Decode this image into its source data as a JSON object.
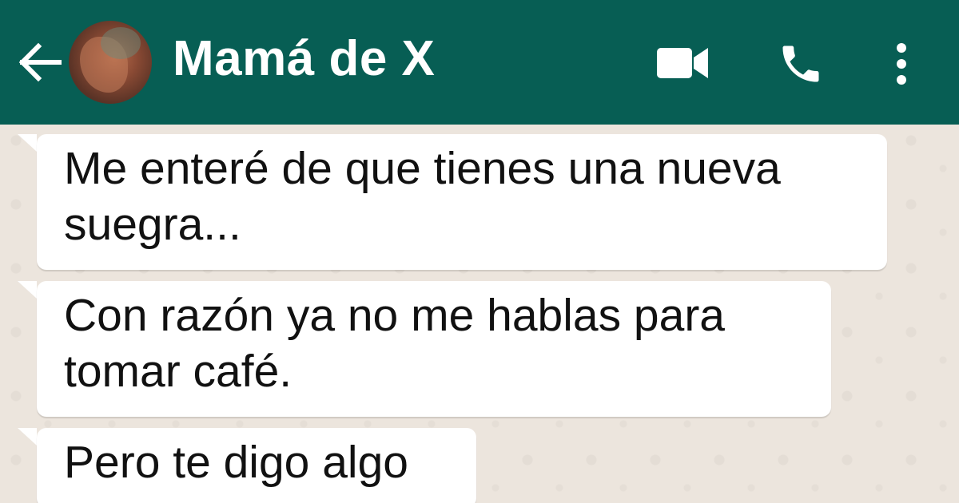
{
  "header": {
    "contact_name": "Mamá de X",
    "icons": [
      "back-arrow-icon",
      "contact-avatar",
      "video-call-icon",
      "voice-call-icon",
      "more-options-icon"
    ],
    "background_color": "#075e54"
  },
  "messages": [
    {
      "line1": "Me enteré de que tienes una nueva",
      "line2": "suegra..."
    },
    {
      "line1": "Con razón ya no me hablas para",
      "line2": "tomar café."
    },
    {
      "line1": "Pero te digo algo"
    }
  ],
  "chat_background_color": "#ece5dd"
}
